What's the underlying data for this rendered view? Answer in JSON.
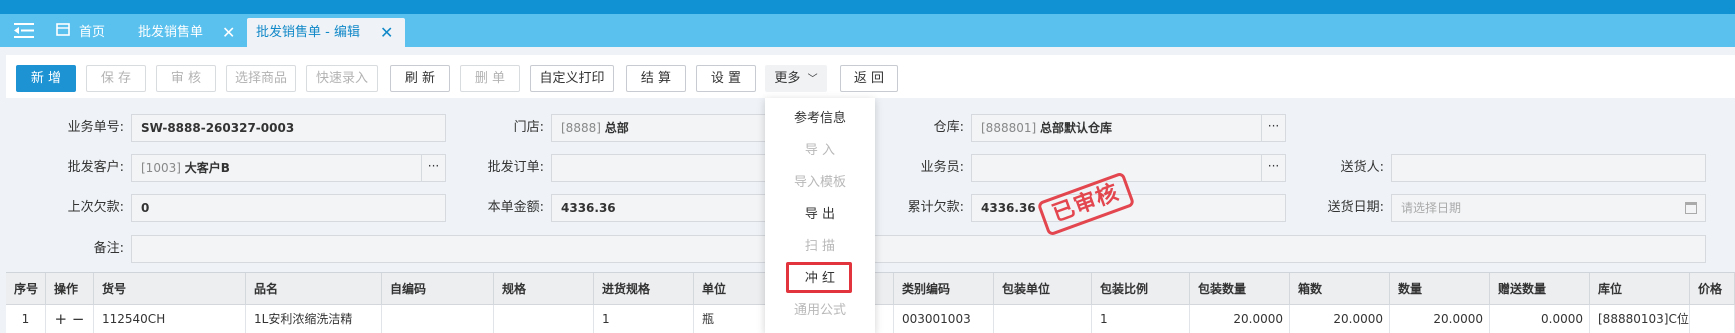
{
  "tabs": [
    {
      "label": "首页"
    },
    {
      "label": "批发销售单"
    },
    {
      "label": "批发销售单 - 编辑"
    }
  ],
  "toolbar": {
    "new": "新 增",
    "save": "保 存",
    "audit": "审 核",
    "select_goods": "选择商品",
    "quick_entry": "快速录入",
    "refresh": "刷 新",
    "delete": "删 单",
    "custom_print": "自定义打印",
    "settle": "结 算",
    "settings": "设 置",
    "more": "更多",
    "back": "返 回"
  },
  "form": {
    "order_no_label": "业务单号:",
    "order_no": "SW-8888-260327-0003",
    "store_label": "门店:",
    "store_code": "[8888]",
    "store_name": "总部",
    "warehouse_label": "仓库:",
    "warehouse_code": "[888801]",
    "warehouse_name": "总部默认仓库",
    "customer_label": "批发客户:",
    "customer_code": "[1003]",
    "customer_name": "大客户B",
    "wholesale_order_label": "批发订单:",
    "salesman_label": "业务员:",
    "deliverer_label": "送货人:",
    "last_debt_label": "上次欠款:",
    "last_debt": "0",
    "amount_label": "本单金额:",
    "amount": "4336.36",
    "total_debt_label": "累计欠款:",
    "total_debt": "4336.36",
    "delivery_date_label": "送货日期:",
    "delivery_date_placeholder": "请选择日期",
    "remark_label": "备注:",
    "dots": "···"
  },
  "stamp": "已审核",
  "more_menu": [
    {
      "label": "参考信息",
      "enabled": true
    },
    {
      "label": "导 入",
      "enabled": false
    },
    {
      "label": "导入模板",
      "enabled": false
    },
    {
      "label": "导 出",
      "enabled": true
    },
    {
      "label": "扫 描",
      "enabled": false
    },
    {
      "label": "冲 红",
      "enabled": true,
      "highlighted": true
    },
    {
      "label": "通用公式",
      "enabled": false
    }
  ],
  "table": {
    "headers": [
      "序号",
      "操作",
      "货号",
      "品名",
      "自编码",
      "规格",
      "进货规格",
      "单位",
      "类别编码",
      "包装单位",
      "包装比例",
      "包装数量",
      "箱数",
      "数量",
      "赠送数量",
      "库位",
      "价格"
    ],
    "row": {
      "seq": "1",
      "ops": "+ −",
      "item_no": "112540CH",
      "name": "1L安利浓缩洗洁精",
      "self_code": "",
      "spec": "",
      "purchase_spec": "1",
      "unit": "瓶",
      "category_code": "003001003",
      "pack_unit": "",
      "pack_ratio": "1",
      "pack_qty": "20.0000",
      "boxes": "20.0000",
      "qty": "20.0000",
      "gift_qty": "0.0000",
      "location": "[88880103]C位",
      "price": ""
    }
  }
}
